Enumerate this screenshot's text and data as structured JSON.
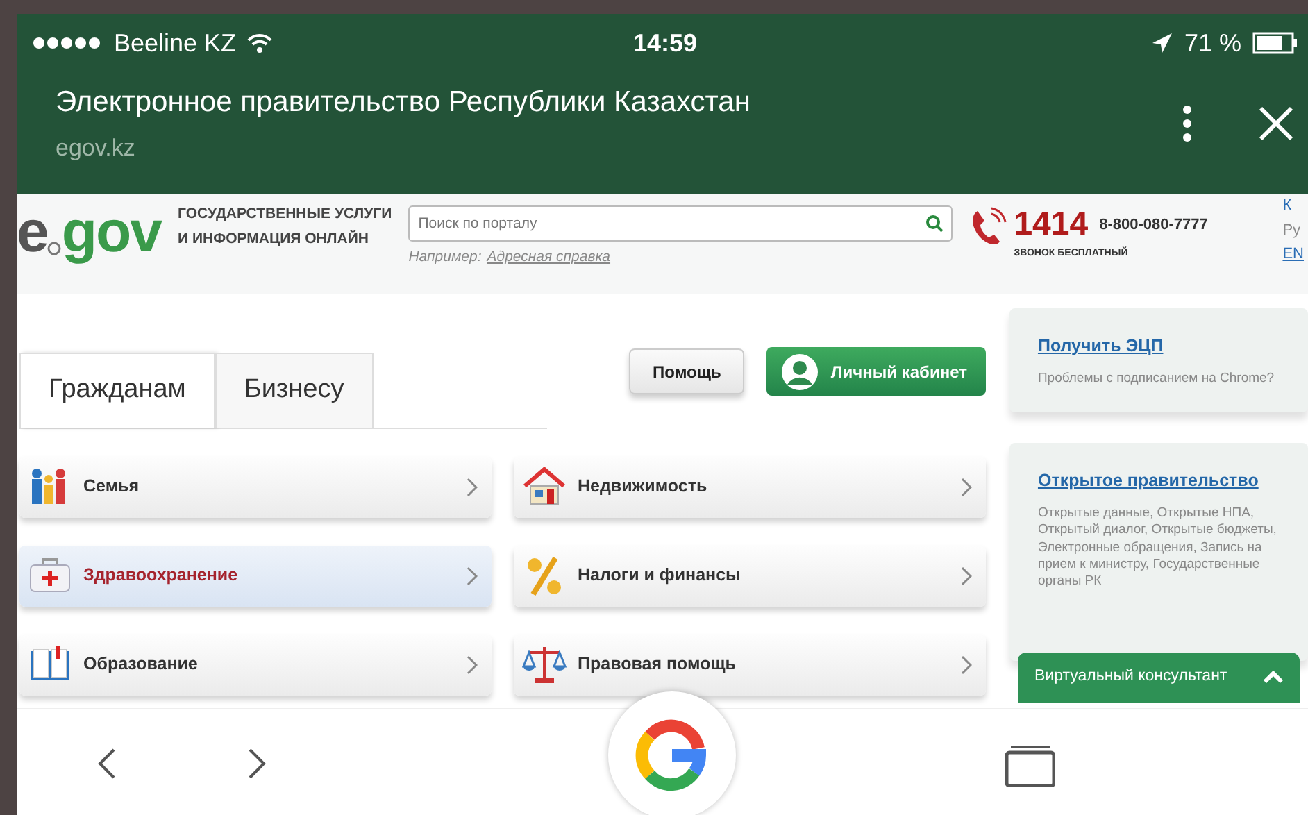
{
  "status_bar": {
    "carrier": "Beeline KZ",
    "time": "14:59",
    "battery": "71 %"
  },
  "browser": {
    "title": "Электронное правительство Республики Казахстан",
    "url": "egov.kz"
  },
  "site_header": {
    "logo": [
      "e",
      "gov"
    ],
    "tagline": [
      "ГОСУДАРСТВЕННЫЕ УСЛУГИ",
      "И ИНФОРМАЦИЯ ОНЛАЙН"
    ],
    "search": {
      "placeholder": "Поиск по порталу"
    },
    "example_label": "Например:",
    "example_link": "Адресная справка",
    "phone": "1414",
    "phone_alt": "8-800-080-7777",
    "phone_note": "ЗВОНОК БЕСПЛАТНЫЙ",
    "edge_links": [
      "К",
      "Ру",
      "EN"
    ]
  },
  "tabs": [
    {
      "label": "Гражданам",
      "selected": true
    },
    {
      "label": "Бизнесу",
      "selected": false
    }
  ],
  "buttons": [
    {
      "label": "Помощь",
      "kind": "plain"
    },
    {
      "label": "Личный кабинет",
      "kind": "account"
    }
  ],
  "categories": [
    {
      "label": "Семья",
      "kind": "family",
      "selected": false
    },
    {
      "label": "Недвижимость",
      "kind": "house",
      "selected": false
    },
    {
      "label": "Здравоохранение",
      "kind": "medkit",
      "selected": true
    },
    {
      "label": "Налоги и финансы",
      "kind": "percent",
      "selected": false
    },
    {
      "label": "Образование",
      "kind": "book",
      "selected": false
    },
    {
      "label": "Правовая помощь",
      "kind": "scales",
      "selected": false
    }
  ],
  "side_cards": [
    {
      "title": "Получить ЭЦП",
      "text": "Проблемы с подписанием на Chrome?"
    },
    {
      "title": "Открытое правительство",
      "text": "Открытые данные, Открытые НПА, Открытый диалог, Открытые бюджеты, Электронные обращения, Запись на прием к министру, Государственные органы РК"
    }
  ],
  "consultant": {
    "label": "Виртуальный консультант"
  }
}
